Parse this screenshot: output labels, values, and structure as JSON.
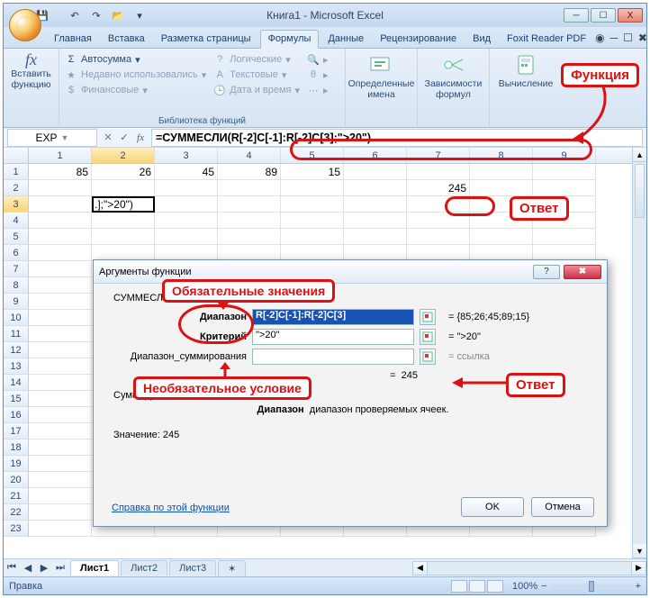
{
  "window": {
    "title": "Книга1 - Microsoft Excel",
    "min": "─",
    "max": "☐",
    "close": "X"
  },
  "qat": {
    "save": "💾",
    "undo": "↶",
    "redo": "↷",
    "open": "📂"
  },
  "tabs": {
    "items": [
      "Главная",
      "Вставка",
      "Разметка страницы",
      "Формулы",
      "Данные",
      "Рецензирование",
      "Вид",
      "Foxit Reader PDF"
    ],
    "active": 3,
    "help": "◉",
    "min": "─",
    "max": "☐",
    "close": "✖"
  },
  "ribbon": {
    "insertfn": {
      "label": "Вставить\nфункцию",
      "fx": "fx"
    },
    "lib": {
      "autosum": "Автосумма",
      "recent": "Недавно использовались",
      "financial": "Финансовые",
      "logical": "Логические",
      "text": "Текстовые",
      "datetime": "Дата и время",
      "more_ic": "▸",
      "group_label": "Библиотека функций"
    },
    "defnames": {
      "label": "Определенные\nимена",
      "drop": "▾"
    },
    "depend": {
      "label": "Зависимости\nформул",
      "drop": "▾"
    },
    "calc": {
      "label": "Вычисление",
      "drop": "▾"
    }
  },
  "formulabar": {
    "name": "EXP",
    "cancel": "✕",
    "enter": "✓",
    "fx": "fx",
    "formula": "=СУММЕСЛИ(R[-2]C[-1]:R[-2]C[3];\">20\")"
  },
  "columns": [
    "1",
    "2",
    "3",
    "4",
    "5",
    "6",
    "7",
    "8",
    "9"
  ],
  "rows_data": [
    {
      "r": "1",
      "cells": [
        "85",
        "26",
        "45",
        "89",
        "15",
        "",
        "",
        "",
        ""
      ]
    },
    {
      "r": "2",
      "cells": [
        "",
        "",
        "",
        "",
        "",
        "",
        "245",
        "",
        ""
      ]
    },
    {
      "r": "3",
      "cells": [
        "",
        ".];\">20\")",
        "",
        "",
        "",
        "",
        "",
        "",
        ""
      ],
      "editing_col": 1
    }
  ],
  "empty_rows": [
    "4",
    "5",
    "6",
    "7",
    "8",
    "9",
    "10",
    "11",
    "12",
    "13",
    "14",
    "15",
    "16",
    "17",
    "18",
    "19",
    "20",
    "21",
    "22",
    "23"
  ],
  "dialog": {
    "title": "Аргументы функции",
    "help": "?",
    "close": "✖",
    "fn": "СУММЕСЛИ",
    "args": {
      "range_label": "Диапазон",
      "range_value": "R[-2]C[-1]:R[-2]C[3]",
      "range_result": "= {85;26;45;89;15}",
      "criteria_label": "Критерий",
      "criteria_value": "\">20\"",
      "criteria_result": "= \">20\"",
      "sumrange_label": "Диапазон_суммирования",
      "sumrange_value": "",
      "sumrange_result": "= ссылка"
    },
    "result_eq": "=",
    "result_val": "245",
    "desc_lead": "Суммирует",
    "desc_param_name": "Диапазон",
    "desc_param_text": "диапазон проверяемых ячеек.",
    "value_label": "Значение:",
    "value_val": "245",
    "help_link": "Справка по этой функции",
    "ok": "OK",
    "cancel": "Отмена"
  },
  "annotations": {
    "func": "Функция",
    "answer": "Ответ",
    "mandatory": "Обязательные значения",
    "optional": "Необязательное условие"
  },
  "sheets": {
    "nav": [
      "⏮",
      "◀",
      "▶",
      "⏭"
    ],
    "tabs": [
      "Лист1",
      "Лист2",
      "Лист3"
    ],
    "new": "✶"
  },
  "status": {
    "mode": "Правка",
    "zoom": "100%",
    "minus": "−",
    "plus": "+"
  }
}
